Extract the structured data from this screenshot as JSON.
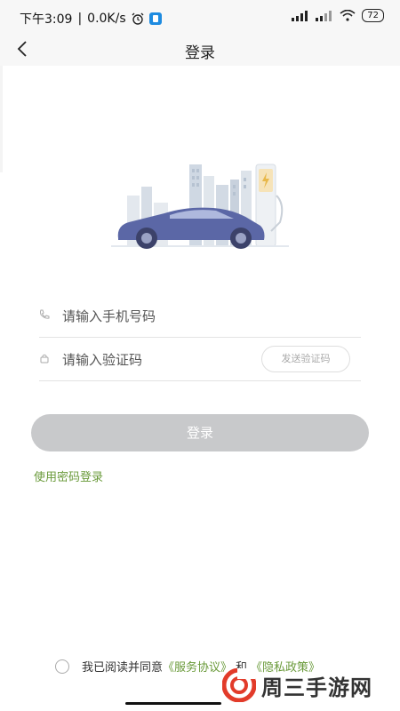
{
  "status_bar": {
    "time": "下午3:09",
    "separator": "|",
    "network_speed": "0.0K/s",
    "battery": "72"
  },
  "header": {
    "title": "登录"
  },
  "form": {
    "phone_placeholder": "请输入手机号码",
    "code_placeholder": "请输入验证码",
    "send_code_label": "发送验证码"
  },
  "login_button": "登录",
  "password_login_link": "使用密码登录",
  "agreement": {
    "prefix": "我已阅读并同意",
    "service_link": "《服务协议》",
    "and": "和",
    "privacy_link": "《隐私政策》"
  },
  "watermark": {
    "text": "周三手游网"
  },
  "colors": {
    "accent_green": "#6a9a3a",
    "button_disabled": "#c8c9cb",
    "car": "#5b67a6",
    "watermark_red": "#e23b2a"
  },
  "icons": [
    "back-arrow-icon",
    "phone-icon",
    "lock-icon",
    "alarm-clock-icon",
    "signal-icon",
    "wifi-icon",
    "battery-icon"
  ]
}
